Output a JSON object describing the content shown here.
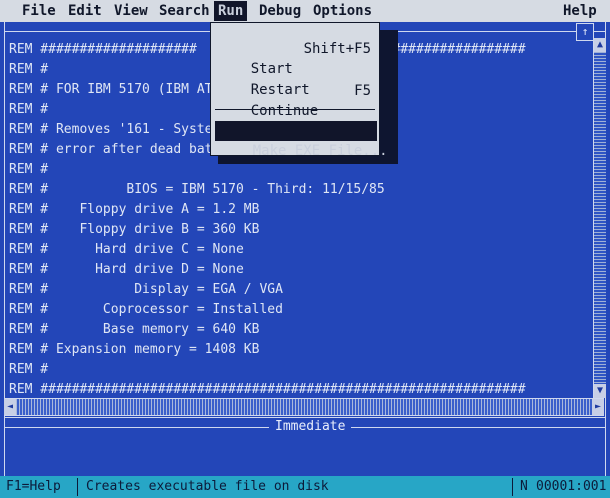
{
  "menubar": {
    "items": [
      "File",
      "Edit",
      "View",
      "Search",
      "Run",
      "Debug",
      "Options"
    ],
    "help": "Help"
  },
  "run_menu": {
    "start": {
      "label": "Start",
      "shortcut": "Shift+F5"
    },
    "restart": {
      "label": "Restart",
      "shortcut": ""
    },
    "continue": {
      "label": "Continue",
      "shortcut": "F5"
    },
    "make_exe": {
      "label": "Make EXE File..."
    }
  },
  "editor": {
    "title_marker": "↑",
    "lines": [
      "REM ####################                  ########################",
      "REM #",
      "REM # FOR IBM 5170 (IBM AT",
      "REM #",
      "REM # Removes '161 - Syste",
      "REM # error after dead bat",
      "REM #",
      "REM #          BIOS = IBM 5170 - Third: 11/15/85",
      "REM #    Floppy drive A = 1.2 MB",
      "REM #    Floppy drive B = 360 KB",
      "REM #      Hard drive C = None",
      "REM #      Hard drive D = None",
      "REM #           Display = EGA / VGA",
      "REM #       Coprocessor = Installed",
      "REM #       Base memory = 640 KB",
      "REM # Expansion memory = 1408 KB",
      "REM #",
      "REM ##############################################################"
    ]
  },
  "immediate": {
    "title": "Immediate"
  },
  "statusbar": {
    "help": "F1=Help",
    "message": "Creates executable file on disk",
    "mode": "N",
    "position": "00001:001"
  }
}
